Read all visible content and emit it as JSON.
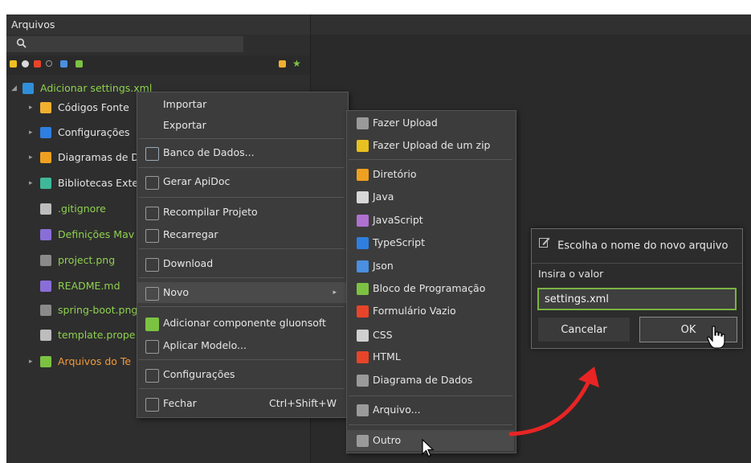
{
  "panel": {
    "title": "Arquivos",
    "search_icon": "search-icon"
  },
  "tree": [
    {
      "label": "Adicionar settings.xml",
      "color": "#8fd14f",
      "icon_color": "#2f8fd8",
      "twisty": "◢"
    },
    {
      "label": "Códigos Fonte",
      "color": "#e4e4e4",
      "icon_color": "#f0b030",
      "twisty": "▸"
    },
    {
      "label": "Configurações",
      "color": "#e4e4e4",
      "icon_color": "#2f7fe0",
      "twisty": "▸"
    },
    {
      "label": "Diagramas de D",
      "color": "#e4e4e4",
      "icon_color": "#f0a020",
      "twisty": "▸"
    },
    {
      "label": "Bibliotecas Exte",
      "color": "#e4e4e4",
      "icon_color": "#3fb89a",
      "twisty": "▸"
    },
    {
      "label": ".gitignore",
      "color": "#8fd14f",
      "icon_color": "#bdbdbd",
      "twisty": ""
    },
    {
      "label": "Definições Mav",
      "color": "#8fd14f",
      "icon_color": "#8a6ed8",
      "twisty": ""
    },
    {
      "label": "project.png",
      "color": "#8fd14f",
      "icon_color": "#8a8a8a",
      "twisty": ""
    },
    {
      "label": "README.md",
      "color": "#8fd14f",
      "icon_color": "#8a6ed8",
      "twisty": ""
    },
    {
      "label": "spring-boot.png",
      "color": "#8fd14f",
      "icon_color": "#8a8a8a",
      "twisty": ""
    },
    {
      "label": "template.prope",
      "color": "#8fd14f",
      "icon_color": "#bdbdbd",
      "twisty": ""
    },
    {
      "label": "Arquivos do Te",
      "color": "#f39a3a",
      "icon_color": "#7cc242",
      "twisty": "▸"
    }
  ],
  "context_menu": {
    "items": [
      {
        "label": "Importar",
        "icon": ""
      },
      {
        "label": "Exportar",
        "icon": ""
      },
      {
        "label": "Banco de Dados...",
        "icon": "database-icon"
      },
      {
        "label": "Gerar ApiDoc",
        "icon": "apidoc-icon"
      },
      {
        "label": "Recompilar Projeto",
        "icon": "tools-icon"
      },
      {
        "label": "Recarregar",
        "icon": "reload-icon"
      },
      {
        "label": "Download",
        "icon": "download-icon"
      },
      {
        "label": "Novo",
        "icon": "new-file-icon",
        "highlighted": true
      },
      {
        "label": "Adicionar componente gluonsoft",
        "icon": "puzzle-icon"
      },
      {
        "label": "Aplicar Modelo...",
        "icon": "template-icon"
      },
      {
        "label": "Configurações",
        "icon": "gear-icon"
      },
      {
        "label": "Fechar",
        "icon": "close-icon",
        "shortcut": "Ctrl+Shift+W"
      }
    ]
  },
  "submenu": {
    "items": [
      {
        "label": "Fazer Upload",
        "icon": "upload-icon"
      },
      {
        "label": "Fazer Upload de um zip",
        "icon": "zip-upload-icon"
      },
      {
        "label": "Diretório",
        "icon": "folder-icon"
      },
      {
        "label": "Java",
        "icon": "java-icon"
      },
      {
        "label": "JavaScript",
        "icon": "javascript-icon"
      },
      {
        "label": "TypeScript",
        "icon": "typescript-icon"
      },
      {
        "label": "Json",
        "icon": "json-icon"
      },
      {
        "label": "Bloco de Programação",
        "icon": "block-icon"
      },
      {
        "label": "Formulário Vazio",
        "icon": "html5-icon"
      },
      {
        "label": "CSS",
        "icon": "css-icon"
      },
      {
        "label": "HTML",
        "icon": "html5-icon"
      },
      {
        "label": "Diagrama de Dados",
        "icon": "diagram-icon"
      },
      {
        "label": "Arquivo...",
        "icon": "new-file-icon"
      },
      {
        "label": "Outro",
        "icon": "file-icon"
      }
    ]
  },
  "dialog": {
    "title": "Escolha o nome do novo arquivo",
    "label": "Insira o valor",
    "input_value": "settings.xml",
    "cancel_label": "Cancelar",
    "ok_label": "OK"
  },
  "colors": {
    "accent_green": "#7bb342",
    "arrow_red": "#e82424"
  }
}
